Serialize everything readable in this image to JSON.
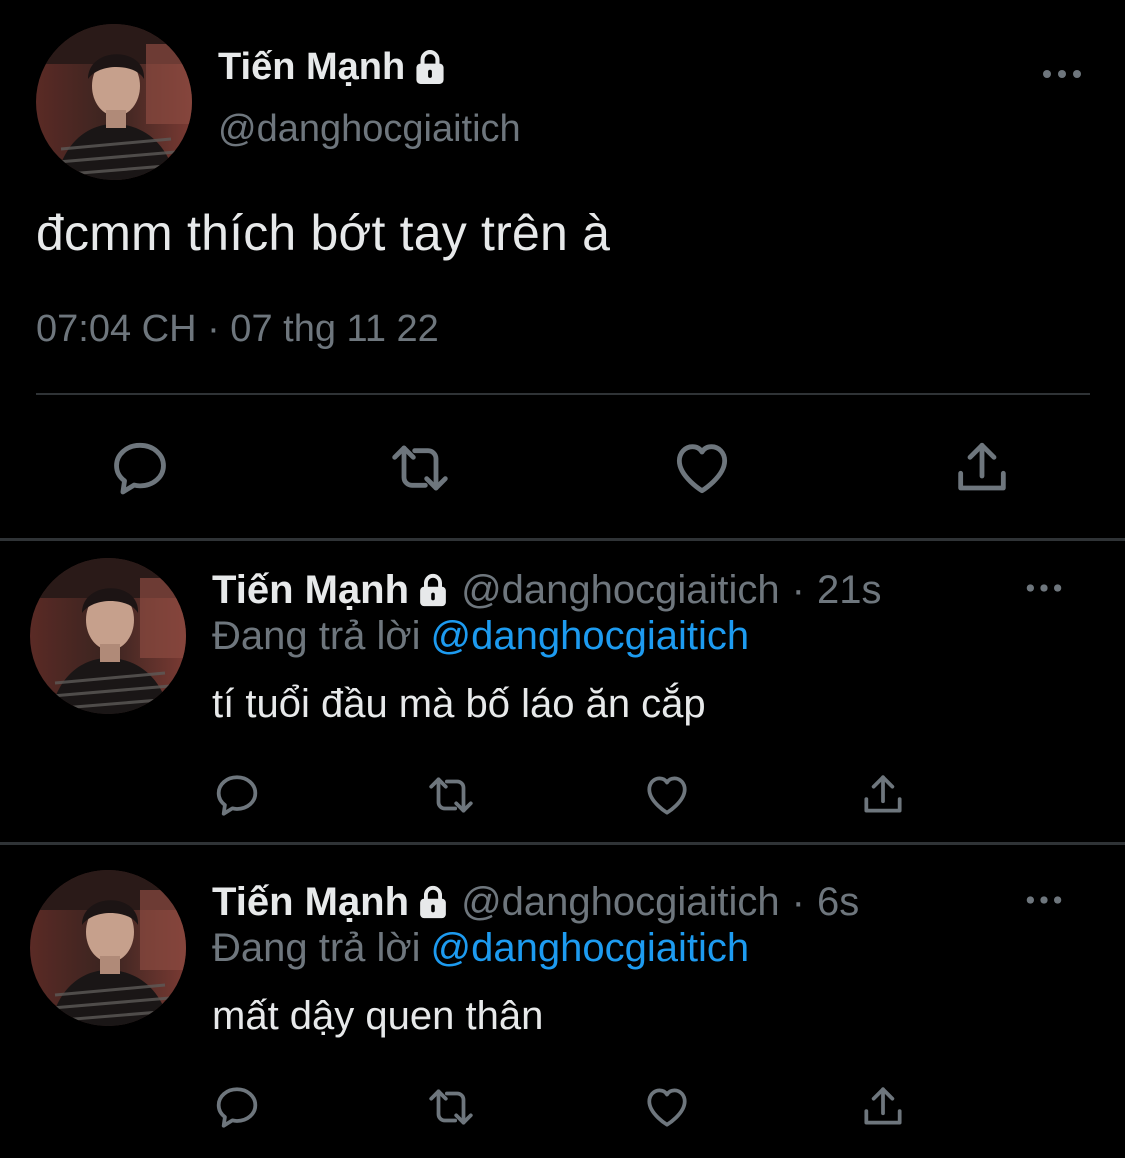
{
  "colors": {
    "background": "#000000",
    "text": "#e7e9ea",
    "muted": "#6e767d",
    "link": "#1d9bf0",
    "divider": "#2f3336"
  },
  "main_tweet": {
    "display_name": "Tiến Mạnh",
    "handle": "@danghocgiaitich",
    "text": "đcmm thích bớt tay trên à",
    "timestamp": "07:04 CH · 07 thg 11 22",
    "icons": [
      "lock-icon",
      "more-icon",
      "reply-icon",
      "retweet-icon",
      "like-icon",
      "share-icon"
    ]
  },
  "replies": [
    {
      "display_name": "Tiến Mạnh",
      "handle": "@danghocgiaitich",
      "separator": "·",
      "time_ago": "21s",
      "replying_label": "Đang trả lời",
      "replying_to": "@danghocgiaitich",
      "text": "tí tuổi đầu mà bố láo ăn cắp"
    },
    {
      "display_name": "Tiến Mạnh",
      "handle": "@danghocgiaitich",
      "separator": "·",
      "time_ago": "6s",
      "replying_label": "Đang trả lời",
      "replying_to": "@danghocgiaitich",
      "text": "mất dậy quen thân"
    }
  ]
}
